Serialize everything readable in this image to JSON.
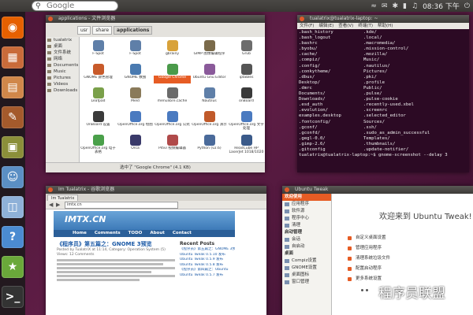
{
  "top_panel": {
    "search_placeholder": "Google",
    "clock": "08:36 下午",
    "tray_icons": [
      "network-icon",
      "mail-icon",
      "bluetooth-icon",
      "battery-icon",
      "volume-icon",
      "chat-icon",
      "power-icon"
    ]
  },
  "launcher": {
    "items": [
      {
        "name": "firefox-icon",
        "color": "#e66000"
      },
      {
        "name": "folder-icon",
        "color": "#c96b3a"
      },
      {
        "name": "files-icon",
        "color": "#d0874a"
      },
      {
        "name": "notes-icon",
        "color": "#a45a2c"
      },
      {
        "name": "apps-icon",
        "color": "#8b8f3a"
      },
      {
        "name": "community-icon",
        "color": "#5b8fc4"
      },
      {
        "name": "disk-icon",
        "color": "#8fb1d8"
      },
      {
        "name": "help-icon",
        "color": "#4b8bd1"
      },
      {
        "name": "software-center-icon",
        "color": "#6aa83a"
      },
      {
        "name": "terminal-icon",
        "color": "#333333"
      }
    ]
  },
  "file_manager": {
    "title": "applications - 文件浏览器",
    "path": [
      "usr",
      "share",
      "applications"
    ],
    "sidebar": [
      "tualatrix",
      "桌面",
      "文件系统",
      "网络",
      "Documents",
      "Music",
      "Pictures",
      "Videos",
      "Downloads"
    ],
    "apps": [
      {
        "label": "F-Spot",
        "color": "#5f7fa8"
      },
      {
        "label": "F-Spot",
        "color": "#5f7fa8"
      },
      {
        "label": "gbrainy",
        "color": "#d8a23a"
      },
      {
        "label": "GIMP 图像编辑程序",
        "color": "#7a6a4a"
      },
      {
        "label": "Grub",
        "color": "#6d6d6d"
      },
      {
        "label": "",
        "color": "#ffffff"
      },
      {
        "label": "GNOME 颜色管理",
        "color": "#c85a2a"
      },
      {
        "label": "GNOME 数独",
        "color": "#4a7ab0"
      },
      {
        "label": "Google Chrome",
        "color": "#4a9a4a"
      },
      {
        "label": "Ubuntu Gnu Editor",
        "color": "#8a5a9a"
      },
      {
        "label": "iptables",
        "color": "#555555"
      },
      {
        "label": "",
        "color": "#ffffff"
      },
      {
        "label": "Leafpad",
        "color": "#7aa04a"
      },
      {
        "label": "Meld",
        "color": "#8a7a5a"
      },
      {
        "label": "menulibre.cache",
        "color": "#6a6a6a"
      },
      {
        "label": "Nautilus",
        "color": "#5f7fa8"
      },
      {
        "label": "onBoard",
        "color": "#3a3a3a"
      },
      {
        "label": "",
        "color": "#ffffff"
      },
      {
        "label": "OnBoard 设置",
        "color": "#3a3a3a"
      },
      {
        "label": "OpenOffice.org 绘图",
        "color": "#4a7ac0"
      },
      {
        "label": "OpenOffice.org 公式",
        "color": "#4a7ac0"
      },
      {
        "label": "OpenOffice.org 演示",
        "color": "#c05a2a"
      },
      {
        "label": "OpenOffice.org 文字处理",
        "color": "#4a7ac0"
      },
      {
        "label": "",
        "color": "#ffffff"
      },
      {
        "label": "OpenOffice.org 电子表格",
        "color": "#4aa04a"
      },
      {
        "label": "Orca",
        "color": "#3a3a6a"
      },
      {
        "label": "Pitivi 视频编辑器",
        "color": "#b04a4a"
      },
      {
        "label": "Python (v2.6)",
        "color": "#4a6a9a"
      },
      {
        "label": "ReadCube HP LaserJet 1018/1020",
        "color": "#3a5a8a"
      },
      {
        "label": "",
        "color": "#ffffff"
      }
    ],
    "selected_app_index": 8,
    "status": "选中了 \"Google Chrome\" (4.1 KB)"
  },
  "terminal": {
    "title": "tualatrix@tualatrix-laptop: ~",
    "menu": [
      "文件(F)",
      "编辑(E)",
      "查看(V)",
      "终端(T)",
      "帮助(H)"
    ],
    "rows": [
      [
        ".bash_history",
        ".kde/"
      ],
      [
        ".bash_logout",
        ".local/"
      ],
      [
        ".bashrc",
        ".macromedia/"
      ],
      [
        ".byobu/",
        ".mission-control/"
      ],
      [
        ".cache/",
        ".mozilla/"
      ],
      [
        ".compiz/",
        "Music/"
      ],
      [
        ".config/",
        ".nautilus/"
      ],
      [
        ".conkytheme/",
        "Pictures/"
      ],
      [
        ".dbus/",
        ".pki/"
      ],
      [
        "Desktop/",
        ".profile"
      ],
      [
        ".dmrc",
        "Public/"
      ],
      [
        "Documents/",
        ".pulse/"
      ],
      [
        "Downloads/",
        ".pulse-cookie"
      ],
      [
        ".esd_auth",
        ".recently-used.xbel"
      ],
      [
        ".evolution/",
        ".screenrc"
      ],
      [
        "examples.desktop",
        ".selected_editor"
      ],
      [
        ".fontconfig/",
        "Sources/"
      ],
      [
        ".gconf/",
        ".ssh/"
      ],
      [
        ".gconfd/",
        ".sudo_as_admin_successful"
      ],
      [
        ".gegl-0.0/",
        "Templates/"
      ],
      [
        ".gimp-2.6/",
        ".thumbnails/"
      ],
      [
        ".gitconfig",
        ".update-notifier/"
      ]
    ],
    "prompt": "tualatrix@tualatrix-laptop:~$ gnome-screenshot --delay 3"
  },
  "browser": {
    "title": "Im Tualatrix - 谷歌浏览器",
    "tab": "Im Tualatrix",
    "url": "imtx.cn",
    "site_logo": "IMTX.CN",
    "nav": [
      "Home",
      "Comments",
      "TODO",
      "About",
      "Contact"
    ],
    "post_title": "《程序员》第五篇之：GNOME 3预览",
    "post_meta": "Posted by TualatriX at 11:14, Category: Operation System (5) Views: 12 Comments",
    "sidebar_heading": "Recent Posts",
    "recent_posts": [
      "《程序员》第五篇之：GNOME 3预览",
      "Ubuntu Tweak 0.5.10 发布",
      "Ubuntu Tweak 0.5.9 发布",
      "Ubuntu Tweak 0.5.8 发布",
      "《程序员》第四篇之：Ubuntu",
      "Ubuntu Tweak 0.5.7 发布"
    ]
  },
  "tweak": {
    "title": "Ubuntu Tweak",
    "sidebar": [
      {
        "kind": "cat",
        "label": "欢迎使用",
        "selected": true
      },
      {
        "kind": "it",
        "label": "应用程序"
      },
      {
        "kind": "it",
        "label": "软件源"
      },
      {
        "kind": "it",
        "label": "程序中心"
      },
      {
        "kind": "it",
        "label": "清理"
      },
      {
        "kind": "cat",
        "label": "启动管理",
        "selected": false
      },
      {
        "kind": "it",
        "label": "会话"
      },
      {
        "kind": "it",
        "label": "自启动"
      },
      {
        "kind": "cat",
        "label": "桌面",
        "selected": false
      },
      {
        "kind": "it",
        "label": "Compiz设置"
      },
      {
        "kind": "it",
        "label": "GNOME设置"
      },
      {
        "kind": "it",
        "label": "桌面图标"
      },
      {
        "kind": "it",
        "label": "窗口管理"
      }
    ],
    "welcome": "欢迎来到 Ubuntu Tweak!",
    "features": [
      "自定义桌面设置",
      "管理应用程序",
      "清理系统垃圾文件",
      "配置启动程序",
      "更多系统设置"
    ]
  },
  "watermark": {
    "text": "程序员联盟"
  }
}
